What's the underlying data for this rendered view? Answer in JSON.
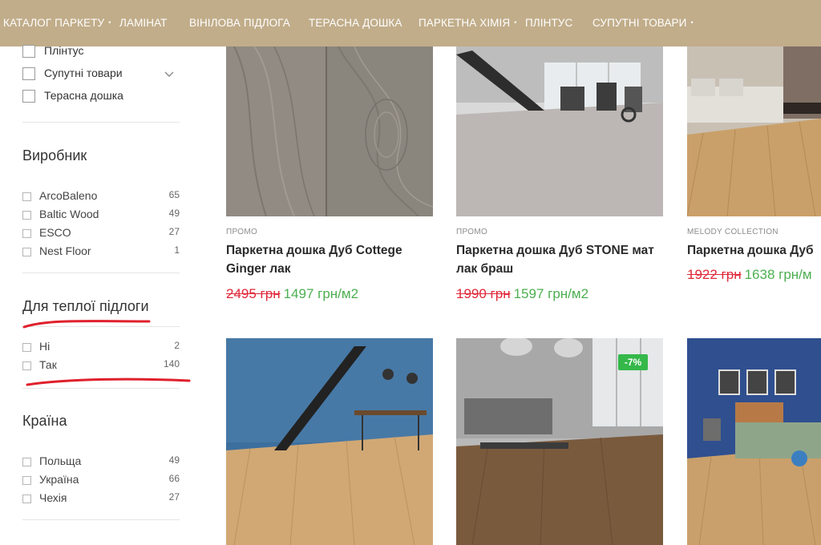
{
  "nav": {
    "items": [
      {
        "label": "КАТАЛОГ ПАРКЕТУ"
      },
      {
        "label": "ЛАМІНАТ"
      },
      {
        "label": "ВІНІЛОВА ПІДЛОГА"
      },
      {
        "label": "ТЕРАСНА ДОШКА"
      },
      {
        "label": "ПАРКЕТНА ХІМІЯ"
      },
      {
        "label": "ПЛІНТУС"
      },
      {
        "label": "СУПУТНІ ТОВАРИ"
      }
    ],
    "dot_glyph": "•"
  },
  "sidebar": {
    "categories": [
      {
        "label": "Плінтус"
      },
      {
        "label": "Супутні товари"
      },
      {
        "label": "Терасна дошка"
      }
    ],
    "manufacturer": {
      "title": "Виробник",
      "options": [
        {
          "label": "ArcoBaleno",
          "count": "65"
        },
        {
          "label": "Baltic Wood",
          "count": "49"
        },
        {
          "label": "ESCO",
          "count": "27"
        },
        {
          "label": "Nest Floor",
          "count": "1"
        }
      ]
    },
    "floor_heating": {
      "title": "Для теплої підлоги",
      "options": [
        {
          "label": "Ні",
          "count": "2"
        },
        {
          "label": "Так",
          "count": "140"
        }
      ]
    },
    "country": {
      "title": "Країна",
      "options": [
        {
          "label": "Польща",
          "count": "49"
        },
        {
          "label": "Україна",
          "count": "66"
        },
        {
          "label": "Чехія",
          "count": "27"
        }
      ]
    }
  },
  "products": [
    {
      "tag": "ПРОМО",
      "name": "Паркетна дошка Дуб Cottege Ginger лак",
      "old_price": "2495 грн",
      "new_price": "1497 грн/м2"
    },
    {
      "tag": "ПРОМО",
      "name": "Паркетна дошка Дуб STONE мат лак браш",
      "old_price": "1990 грн",
      "new_price": "1597 грн/м2"
    },
    {
      "tag": "MELODY COLLECTION",
      "name": "Паркетна дошка Дуб",
      "old_price": "1922 грн",
      "new_price": "1638 грн/м"
    },
    {
      "tag": "",
      "name": "",
      "old_price": "",
      "new_price": ""
    },
    {
      "tag": "",
      "name": "",
      "old_price": "",
      "new_price": "",
      "badge": "-7%"
    },
    {
      "tag": "",
      "name": "",
      "old_price": "",
      "new_price": ""
    }
  ],
  "colors": {
    "nav_bg": "#c1ad8a",
    "price_old": "#e0283a",
    "price_new": "#4caf50",
    "badge_bg": "#35b84a",
    "annotation": "#e0202c"
  }
}
